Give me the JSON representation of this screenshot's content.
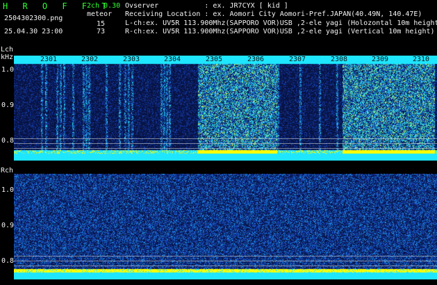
{
  "app": {
    "title": "H R O F F T",
    "mode": "2ch 0.30",
    "mode_label": "meteor",
    "lch_count": "15",
    "rch_count": "73"
  },
  "file": {
    "name": "2504302300.png",
    "datetime": "25.04.30 23:00"
  },
  "info": {
    "observer": "Ovserver           : ex. JR7CYX [ kid ]",
    "location": "Receiving Location : ex. Aomori City Aomori-Pref.JAPAN(40.49N, 140.47E)",
    "lch": "L-ch:ex. UV5R 113.900Mhz(SAPPORO VOR)USB ,2-ele yagi (Holozontal 10m height)",
    "rch": "R-ch:ex. UV5R 113.900Mhz(SAPPORO VOR)USB ,2-ele yagi (Vertical 10m height)"
  },
  "lch_panel": {
    "label": "Lch",
    "unit": "kHz",
    "yticks": [
      "1.0",
      "0.9",
      "0.8"
    ],
    "time_ticks": [
      "2301",
      "2302",
      "2303",
      "2304",
      "2305",
      "2306",
      "2307",
      "2308",
      "2309",
      "2310"
    ]
  },
  "rch_panel": {
    "label": "Rch",
    "yticks": [
      "1.0",
      "0.9",
      "0.8"
    ]
  },
  "colors": {
    "background": "#000000",
    "dark_blue": "#0a1a55",
    "cyan": "#1fe6ff",
    "yellow": "#ffff00",
    "green": "#32ff32"
  }
}
